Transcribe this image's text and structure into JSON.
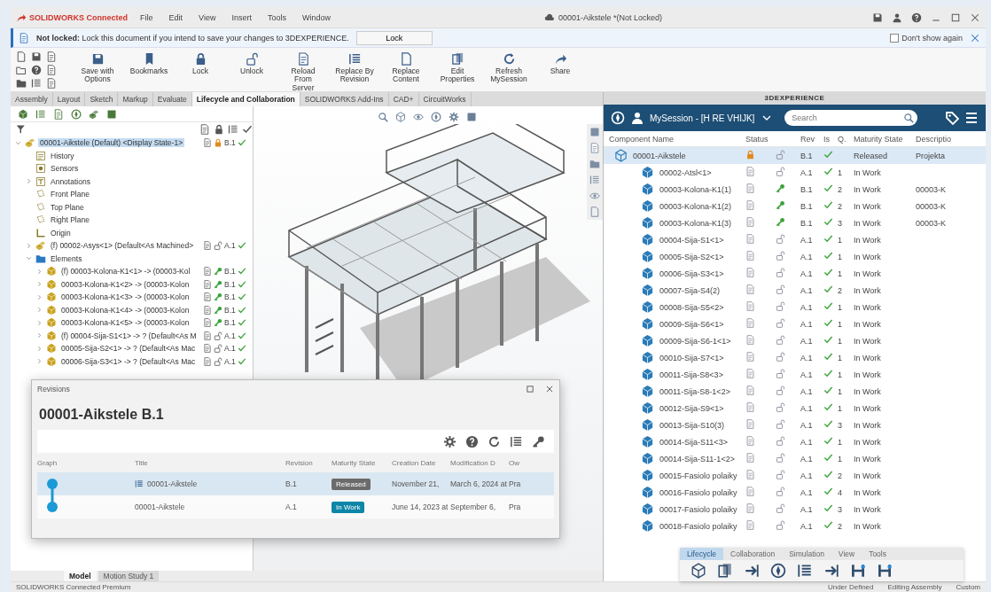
{
  "titlebar": {
    "brand": "SOLIDWORKS Connected",
    "menus": [
      "File",
      "Edit",
      "View",
      "Insert",
      "Tools",
      "Window"
    ],
    "title": "00001-Aikstele *(Not Locked)"
  },
  "notice": {
    "text": "**Not locked:** Lock this document if you intend to save your changes to 3DEXPERIENCE.",
    "button": "Lock",
    "dont_show": {
      "label": "Don't show again",
      "checked": false
    }
  },
  "ribbon": {
    "buttons": [
      "Save with Options",
      "Bookmarks",
      "Lock",
      "Unlock",
      "Reload From Server",
      "Replace By Revision",
      "Replace Content",
      "Edit Properties",
      "Refresh MySession",
      "Share"
    ]
  },
  "command_tabs": [
    {
      "label": "Assembly",
      "selected": false
    },
    {
      "label": "Layout",
      "selected": false
    },
    {
      "label": "Sketch",
      "selected": false
    },
    {
      "label": "Markup",
      "selected": false
    },
    {
      "label": "Evaluate",
      "selected": false
    },
    {
      "label": "Lifecycle and Collaboration",
      "selected": true
    },
    {
      "label": "SOLIDWORKS Add-Ins",
      "selected": false
    },
    {
      "label": "CAD+",
      "selected": false
    },
    {
      "label": "CircuitWorks",
      "selected": false
    }
  ],
  "tree": {
    "items": [
      {
        "label": "00001-Aikstele (Default) <Display State-1>",
        "kind": "assembly",
        "selected": true,
        "rev": "B.1",
        "locked": true,
        "expanded": true,
        "children": [
          {
            "label": "History",
            "kind": "history",
            "selected": false
          },
          {
            "label": "Sensors",
            "kind": "sensor",
            "selected": false
          },
          {
            "label": "Annotations",
            "kind": "annotation",
            "selected": false,
            "expanded": false
          },
          {
            "label": "Front Plane",
            "kind": "plane",
            "selected": false
          },
          {
            "label": "Top Plane",
            "kind": "plane",
            "selected": false
          },
          {
            "label": "Right Plane",
            "kind": "plane",
            "selected": false
          },
          {
            "label": "Origin",
            "kind": "origin",
            "selected": false
          },
          {
            "label": "(f) 00002-Asys<1> (Default<As Machined>",
            "kind": "assembly",
            "selected": false,
            "expanded": false,
            "rev": "A.1",
            "locked": false,
            "reserved": false
          },
          {
            "label": "Elements",
            "kind": "folder",
            "selected": false,
            "expanded": true,
            "children": [
              {
                "label": "(f) 00003-Kolona-K1<1> -> (00003-Kol",
                "kind": "part",
                "selected": false,
                "expanded": false,
                "rev": "B.1",
                "locked": false,
                "reserved": true
              },
              {
                "label": "00003-Kolona-K1<2> -> (00003-Kolon",
                "kind": "part",
                "selected": false,
                "expanded": false,
                "rev": "B.1",
                "locked": false,
                "reserved": true
              },
              {
                "label": "00003-Kolona-K1<3> -> (00003-Kolon",
                "kind": "part",
                "selected": false,
                "expanded": false,
                "rev": "B.1",
                "locked": false,
                "reserved": true
              },
              {
                "label": "00003-Kolona-K1<4> -> (00003-Kolon",
                "kind": "part",
                "selected": false,
                "expanded": false,
                "rev": "B.1",
                "locked": false,
                "reserved": true
              },
              {
                "label": "00003-Kolona-K1<5> -> (00003-Kolon",
                "kind": "part",
                "selected": false,
                "expanded": false,
                "rev": "B.1",
                "locked": false,
                "reserved": true
              },
              {
                "label": "(f) 00004-Sija-S1<1> -> ? (Default<As M",
                "kind": "part",
                "selected": false,
                "expanded": false,
                "rev": "A.1",
                "locked": false,
                "reserved": false
              },
              {
                "label": "00005-Sija-S2<1> -> ? (Default<As Mac",
                "kind": "part",
                "selected": false,
                "expanded": false,
                "rev": "A.1",
                "locked": false,
                "reserved": false
              },
              {
                "label": "00006-Sija-S3<1> -> ? (Default<As Mac",
                "kind": "part",
                "selected": false,
                "expanded": false,
                "rev": "A.1",
                "locked": false,
                "reserved": false
              }
            ]
          }
        ]
      }
    ]
  },
  "model_tabs": [
    {
      "label": "Model",
      "selected": true
    },
    {
      "label": "Motion Study 1",
      "selected": false
    }
  ],
  "experience": {
    "header": "3DEXPERIENCE",
    "session": "MySession - [H RE VHIJK]",
    "search": {
      "placeholder": "Search"
    },
    "columns": [
      "Component Name",
      "Status",
      "Rev",
      "Is",
      "Q.",
      "Maturity State",
      "Descriptio"
    ],
    "rows": [
      {
        "name": "00001-Aikstele",
        "kind": "assembly",
        "locked": true,
        "reserved": false,
        "rev": "B.1",
        "maturity": "Released",
        "description": "Projekta",
        "selected": true,
        "children": [
          {
            "name": "00002-Atsl<1>",
            "kind": "part",
            "locked": false,
            "reserved": false,
            "rev": "A.1",
            "q": "1",
            "maturity": "In Work",
            "selected": false
          },
          {
            "name": "00003-Kolona-K1(1)",
            "kind": "part",
            "locked": false,
            "reserved": true,
            "rev": "B.1",
            "q": "2",
            "maturity": "In Work",
            "description": "00003-K",
            "selected": false
          },
          {
            "name": "00003-Kolona-K1(2)",
            "kind": "part",
            "locked": false,
            "reserved": true,
            "rev": "B.1",
            "q": "2",
            "maturity": "In Work",
            "description": "00003-K",
            "selected": false
          },
          {
            "name": "00003-Kolona-K1(3)",
            "kind": "part",
            "locked": false,
            "reserved": true,
            "rev": "B.1",
            "q": "3",
            "maturity": "In Work",
            "description": "00003-K",
            "selected": false
          },
          {
            "name": "00004-Sija-S1<1>",
            "kind": "part",
            "locked": false,
            "reserved": false,
            "rev": "A.1",
            "q": "1",
            "maturity": "In Work",
            "selected": false
          },
          {
            "name": "00005-Sija-S2<1>",
            "kind": "part",
            "locked": false,
            "reserved": false,
            "rev": "A.1",
            "q": "1",
            "maturity": "In Work",
            "selected": false
          },
          {
            "name": "00006-Sija-S3<1>",
            "kind": "part",
            "locked": false,
            "reserved": false,
            "rev": "A.1",
            "q": "1",
            "maturity": "In Work",
            "selected": false
          },
          {
            "name": "00007-Sija-S4(2)",
            "kind": "part",
            "locked": false,
            "reserved": false,
            "rev": "A.1",
            "q": "2",
            "maturity": "In Work",
            "selected": false
          },
          {
            "name": "00008-Sija-S5<2>",
            "kind": "part",
            "locked": false,
            "reserved": false,
            "rev": "A.1",
            "q": "1",
            "maturity": "In Work",
            "selected": false
          },
          {
            "name": "00009-Sija-S6<1>",
            "kind": "part",
            "locked": false,
            "reserved": false,
            "rev": "A.1",
            "q": "1",
            "maturity": "In Work",
            "selected": false
          },
          {
            "name": "00009-Sija-S6-1<1>",
            "kind": "part",
            "locked": false,
            "reserved": false,
            "rev": "A.1",
            "q": "1",
            "maturity": "In Work",
            "selected": false
          },
          {
            "name": "00010-Sija-S7<1>",
            "kind": "part",
            "locked": false,
            "reserved": false,
            "rev": "A.1",
            "q": "1",
            "maturity": "In Work",
            "selected": false
          },
          {
            "name": "00011-Sija-S8<3>",
            "kind": "part",
            "locked": false,
            "reserved": false,
            "rev": "A.1",
            "q": "1",
            "maturity": "In Work",
            "selected": false
          },
          {
            "name": "00011-Sija-S8-1<2>",
            "kind": "part",
            "locked": false,
            "reserved": false,
            "rev": "A.1",
            "q": "1",
            "maturity": "In Work",
            "selected": false
          },
          {
            "name": "00012-Sija-S9<1>",
            "kind": "part",
            "locked": false,
            "reserved": false,
            "rev": "A.1",
            "q": "1",
            "maturity": "In Work",
            "selected": false
          },
          {
            "name": "00013-Sija-S10(3)",
            "kind": "part",
            "locked": false,
            "reserved": false,
            "rev": "A.1",
            "q": "3",
            "maturity": "In Work",
            "selected": false
          },
          {
            "name": "00014-Sija-S11<3>",
            "kind": "part",
            "locked": false,
            "reserved": false,
            "rev": "A.1",
            "q": "1",
            "maturity": "In Work",
            "selected": false
          },
          {
            "name": "00014-Sija-S11-1<2>",
            "kind": "part",
            "locked": false,
            "reserved": false,
            "rev": "A.1",
            "q": "1",
            "maturity": "In Work",
            "selected": false
          },
          {
            "name": "00015-Fasiolo polaiky",
            "kind": "part",
            "locked": false,
            "reserved": false,
            "rev": "A.1",
            "q": "2",
            "maturity": "In Work",
            "selected": false
          },
          {
            "name": "00016-Fasiolo polaiky",
            "kind": "part",
            "locked": false,
            "reserved": false,
            "rev": "A.1",
            "q": "4",
            "maturity": "In Work",
            "selected": false
          },
          {
            "name": "00017-Fasiolo polaiky",
            "kind": "part",
            "locked": false,
            "reserved": false,
            "rev": "A.1",
            "q": "3",
            "maturity": "In Work",
            "selected": false
          },
          {
            "name": "00018-Fasiolo polaiky",
            "kind": "part",
            "locked": false,
            "reserved": false,
            "rev": "A.1",
            "q": "2",
            "maturity": "In Work",
            "selected": false
          }
        ]
      }
    ],
    "toolbar_tabs": [
      {
        "label": "Lifecycle",
        "selected": true
      },
      {
        "label": "Collaboration",
        "selected": false
      },
      {
        "label": "Simulation",
        "selected": false
      },
      {
        "label": "View",
        "selected": false
      },
      {
        "label": "Tools",
        "selected": false
      }
    ]
  },
  "revisions": {
    "title": "Revisions",
    "heading": "00001-Aikstele B.1",
    "columns": [
      "Graph",
      "Title",
      "Revision",
      "Maturity State",
      "Creation Date",
      "Modification D",
      "Ow"
    ],
    "rows": [
      {
        "title": "00001-Aikstele",
        "revision": "B.1",
        "maturity": "Released",
        "color": "#6b6b6b",
        "created": "November 21,",
        "modified": "March 6, 2024 at",
        "owner": "Pra",
        "selected": true
      },
      {
        "title": "00001-Aikstele",
        "revision": "A.1",
        "maturity": "In Work",
        "color": "#0e86a8",
        "created": "June 14, 2023 at",
        "modified": "September 6,",
        "owner": "Pra",
        "selected": false
      }
    ]
  },
  "status_bar": {
    "product": "SOLIDWORKS Connected Premium",
    "items": [
      "Under Defined",
      "Editing Assembly",
      "Custom"
    ]
  }
}
